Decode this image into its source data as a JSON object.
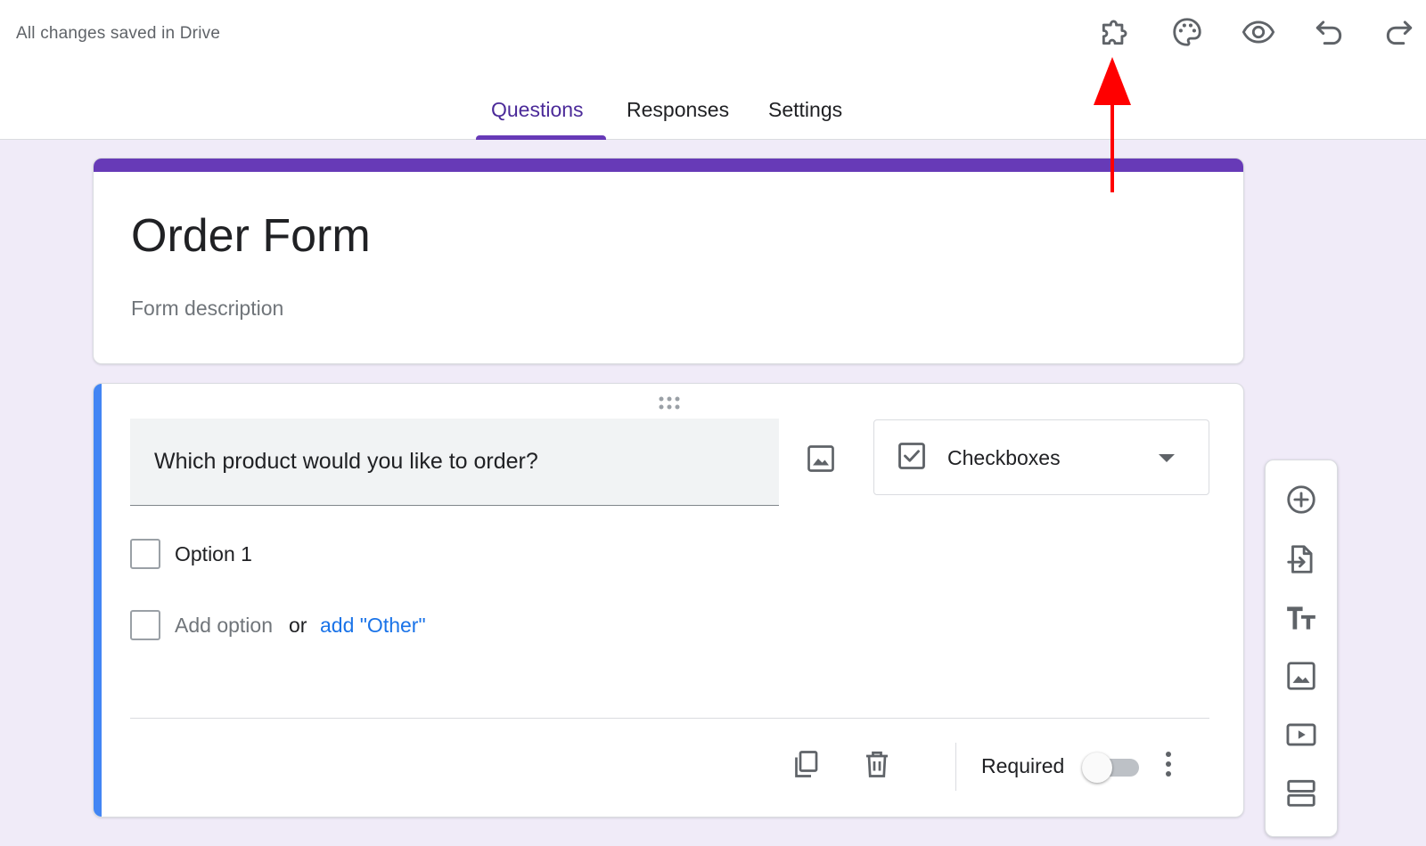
{
  "header": {
    "save_status": "All changes saved in Drive",
    "toolbar_icons": [
      "addons-icon",
      "palette-icon",
      "preview-eye-icon",
      "undo-icon",
      "redo-icon"
    ]
  },
  "tabs": [
    {
      "label": "Questions",
      "active": true
    },
    {
      "label": "Responses",
      "active": false
    },
    {
      "label": "Settings",
      "active": false
    }
  ],
  "form": {
    "title": "Order Form",
    "description_placeholder": "Form description"
  },
  "question": {
    "text": "Which product would you like to order?",
    "type": "Checkboxes",
    "options": [
      "Option 1"
    ],
    "add_option_label": "Add option",
    "or_label": "or",
    "add_other_label": "add \"Other\"",
    "required_label": "Required",
    "required_on": false
  },
  "side_toolbar": {
    "icons": [
      "add-question-icon",
      "import-questions-icon",
      "add-title-icon",
      "add-image-icon",
      "add-video-icon",
      "add-section-icon"
    ]
  },
  "colors": {
    "background": "#f0ebf8",
    "accent_purple": "#673ab7",
    "active_tab_text": "#4b2a99",
    "question_accent_blue": "#4285f4",
    "link_blue": "#1a73e8",
    "annotation_red": "#ff0000"
  }
}
